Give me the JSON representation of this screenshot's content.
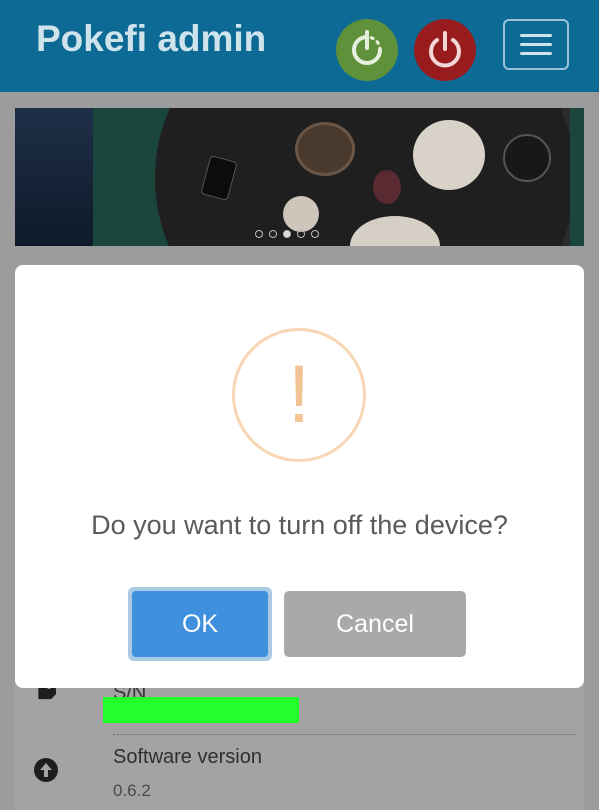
{
  "header": {
    "title": "Pokefi admin",
    "reboot_icon": "reboot-icon",
    "power_icon": "power-icon",
    "menu_icon": "hamburger-menu-icon"
  },
  "banner": {
    "slide_count": 5,
    "active_slide": 3
  },
  "dialog": {
    "icon": "warning-icon",
    "icon_glyph": "!",
    "question": "Do you want to turn off the device?",
    "ok_label": "OK",
    "cancel_label": "Cancel"
  },
  "list": {
    "sn_label": "S/N",
    "software_version_label": "Software version",
    "software_version_value": "0.6.2"
  },
  "colors": {
    "header_bg": "#0d6a94",
    "reboot_green": "#5e913a",
    "power_red": "#981c1e",
    "ok_blue": "#3f91dd",
    "cancel_gray": "#a9a9a9",
    "warning_orange": "#f2c495",
    "sn_highlight": "#22ff2a"
  }
}
